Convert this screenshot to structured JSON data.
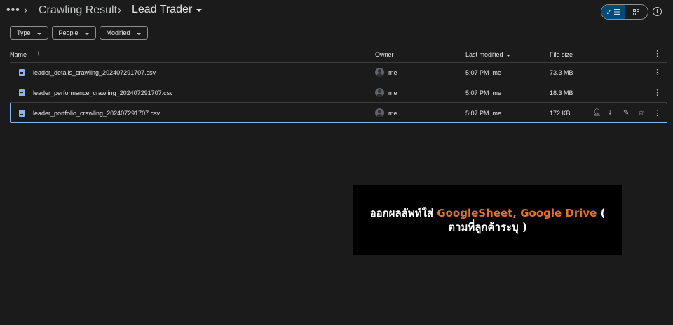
{
  "breadcrumb": {
    "more": "•••",
    "parent": "Crawling Result",
    "current": "Lead Trader"
  },
  "filters": [
    "Type",
    "People",
    "Modified"
  ],
  "columns": {
    "name": "Name",
    "owner": "Owner",
    "last_modified": "Last modified",
    "file_size": "File size"
  },
  "rows": [
    {
      "name": "leader_details_crawling_202407291707.csv",
      "owner": "me",
      "modified": "5:07 PM  me",
      "size": "73.3 MB"
    },
    {
      "name": "leader_performance_crawling_202407291707.csv",
      "owner": "me",
      "modified": "5:07 PM  me",
      "size": "18.3 MB"
    },
    {
      "name": "leader_portfolio_crawling_202407291707.csv",
      "owner": "me",
      "modified": "5:07 PM  me",
      "size": "172 KB"
    }
  ],
  "overlay": {
    "prefix": "ออกผลลัพท์ใส่ ",
    "highlight": "GoogleSheet, Google Drive",
    "suffix": " ( ตามที่ลูกค้าระบุ )"
  },
  "colors": {
    "background": "#1b1b1c",
    "accent": "#8ab4f8",
    "highlight": "#e8711e"
  },
  "icons": [
    "more-horiz-icon",
    "chevron-right-icon",
    "check-icon",
    "list-icon",
    "grid-icon",
    "info-icon",
    "sort-up-icon",
    "csv-file-icon",
    "share-icon",
    "download-icon",
    "rename-icon",
    "star-icon",
    "more-vert-icon"
  ]
}
